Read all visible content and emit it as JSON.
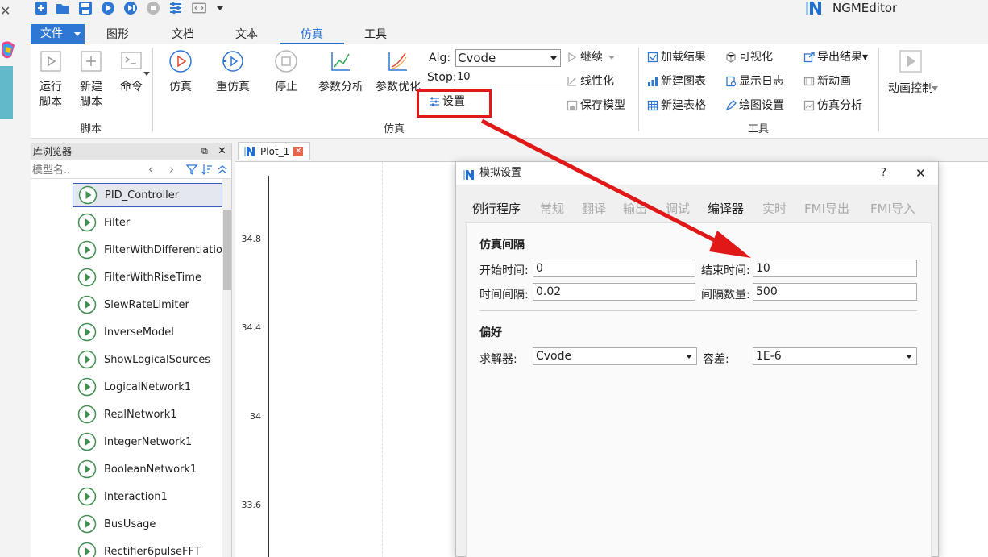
{
  "app": {
    "title": "NGMEditor",
    "brand_color": "#1f6fd1"
  },
  "quick_toolbar": {
    "icons": [
      "new-icon",
      "open-folder-icon",
      "save-icon",
      "run-icon",
      "run-to-icon",
      "stop-icon",
      "settings-sliders-icon",
      "code-icon",
      "dropdown-arrow-icon"
    ]
  },
  "tabs": {
    "file": "文件",
    "items": [
      {
        "label": "图形"
      },
      {
        "label": "文档"
      },
      {
        "label": "文本"
      },
      {
        "label": "仿真",
        "active": true
      },
      {
        "label": "工具"
      }
    ]
  },
  "ribbon": {
    "script_group": {
      "label": "脚本",
      "run_script": "运行\n脚本",
      "new_script": "新建\n脚本",
      "command": "命令"
    },
    "sim_group": {
      "label": "仿真",
      "simulate": "仿真",
      "resimulate": "重仿真",
      "stop": "停止",
      "param_analysis": "参数分析",
      "param_optimize": "参数优化",
      "alg_label": "Alg:",
      "alg_value": "Cvode",
      "stop_label": "Stop:",
      "stop_value": "10",
      "settings": "设置",
      "continue": "继续",
      "linearize": "线性化",
      "save_model": "保存模型"
    },
    "tools_group": {
      "label": "工具",
      "load_result": "加载结果",
      "new_chart": "新建图表",
      "new_table": "新建表格",
      "visualize": "可视化",
      "show_log": "显示日志",
      "plot_settings": "绘图设置",
      "export_result": "导出结果▾",
      "new_animation": "新动画",
      "sim_analysis": "仿真分析",
      "animation_control": "动画控制"
    },
    "highlight_color": "#e01818"
  },
  "library": {
    "title": "库浏览器",
    "search_placeholder": "模型名..",
    "items": [
      {
        "label": "PID_Controller",
        "selected": true
      },
      {
        "label": "Filter"
      },
      {
        "label": "FilterWithDifferentiation"
      },
      {
        "label": "FilterWithRiseTime"
      },
      {
        "label": "SlewRateLimiter"
      },
      {
        "label": "InverseModel"
      },
      {
        "label": "ShowLogicalSources"
      },
      {
        "label": "LogicalNetwork1"
      },
      {
        "label": "RealNetwork1"
      },
      {
        "label": "IntegerNetwork1"
      },
      {
        "label": "BooleanNetwork1"
      },
      {
        "label": "Interaction1"
      },
      {
        "label": "BusUsage"
      },
      {
        "label": "Rectifier6pulseFFT"
      }
    ]
  },
  "plot": {
    "tab_label": "Plot_1",
    "y_ticks": [
      "34.8",
      "34.4",
      "34",
      "33.6"
    ]
  },
  "dialog": {
    "title": "模拟设置",
    "help": "?",
    "tabs": [
      {
        "label": "例行程序",
        "active": true
      },
      {
        "label": "常规"
      },
      {
        "label": "翻译"
      },
      {
        "label": "输出"
      },
      {
        "label": "调试"
      },
      {
        "label": "编译器",
        "enabled": true
      },
      {
        "label": "实时"
      },
      {
        "label": "FMI导出"
      },
      {
        "label": "FMI导入"
      }
    ],
    "interval_heading": "仿真间隔",
    "start_time_label": "开始时间:",
    "start_time_value": "0",
    "end_time_label": "结束时间:",
    "end_time_value": "10",
    "time_step_label": "时间间隔:",
    "time_step_value": "0.02",
    "interval_count_label": "间隔数量:",
    "interval_count_value": "500",
    "pref_heading": "偏好",
    "solver_label": "求解器:",
    "solver_value": "Cvode",
    "tolerance_label": "容差:",
    "tolerance_value": "1E-6"
  }
}
